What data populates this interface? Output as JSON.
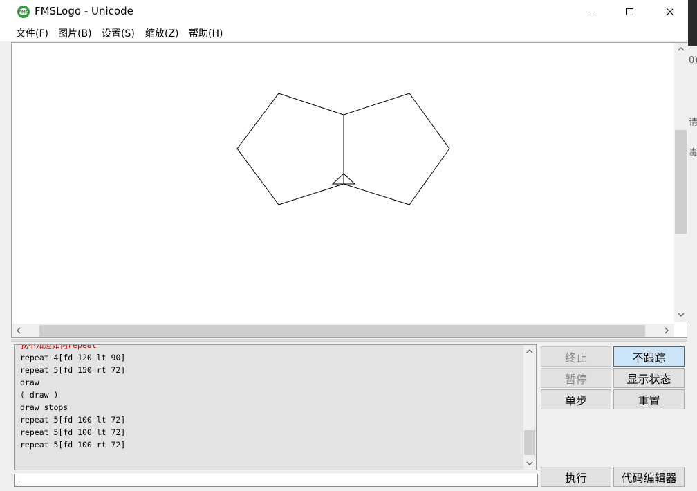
{
  "window": {
    "title": "FMSLogo - Unicode",
    "controls": {
      "minimize": "—",
      "maximize": "☐",
      "close": "✕"
    }
  },
  "menu": {
    "items": [
      "文件(F)",
      "图片(B)",
      "设置(S)",
      "缩放(Z)",
      "帮助(H)"
    ]
  },
  "graphics": {
    "stroke_color": "#000000",
    "background": "#ffffff",
    "drawing": "two pentagons sharing a vertical edge with turtle at bottom vertex"
  },
  "history": {
    "lines": [
      {
        "text": "我不知道如何repeat",
        "color": "#cc0000"
      },
      {
        "text": "repeat 4[fd 120 lt 90]",
        "color": "#000000"
      },
      {
        "text": "repeat 5[fd 150 rt 72]",
        "color": "#000000"
      },
      {
        "text": "draw",
        "color": "#000000"
      },
      {
        "text": "( draw )",
        "color": "#000000"
      },
      {
        "text": "draw stops",
        "color": "#000000"
      },
      {
        "text": "repeat 5[fd 100 lt 72]",
        "color": "#000000"
      },
      {
        "text": "repeat 5[fd 100 lt 72]",
        "color": "#000000"
      },
      {
        "text": "repeat 5[fd 100 rt 72]",
        "color": "#000000"
      }
    ]
  },
  "input": {
    "value": ""
  },
  "buttons": {
    "halt": "终止",
    "trace": "不跟踪",
    "pause": "暂停",
    "status": "显示状态",
    "step": "单步",
    "reset": "重置",
    "execute": "执行",
    "editor": "代码编辑器"
  },
  "edge_glimpse": {
    "t1": "0)",
    "t2": "请",
    "t3": "毒"
  }
}
